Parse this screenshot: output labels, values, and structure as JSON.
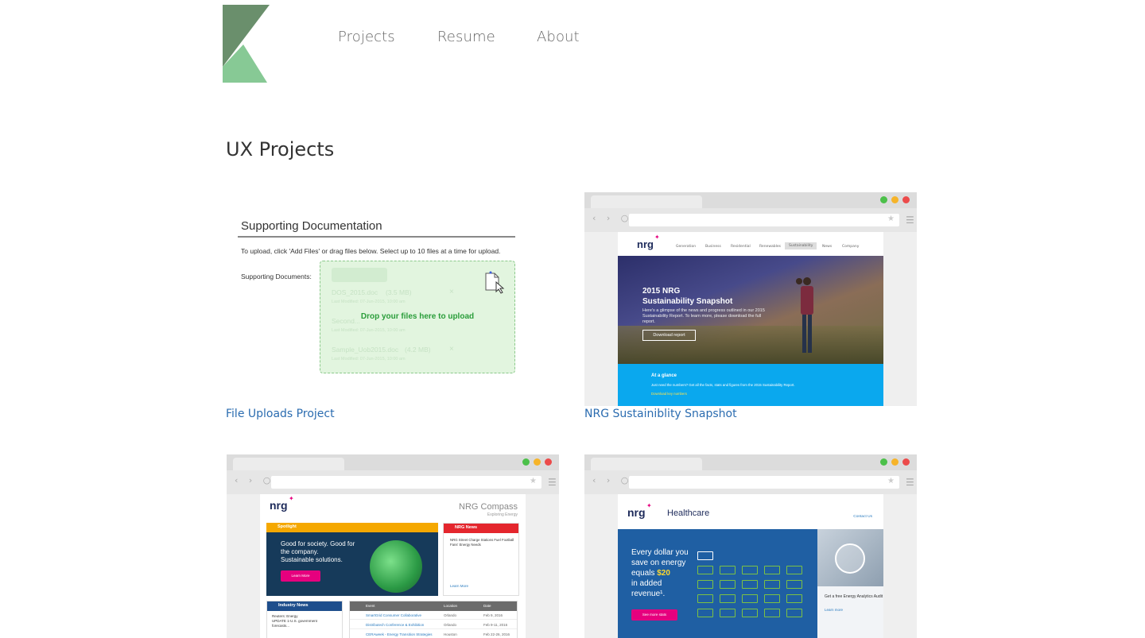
{
  "nav": {
    "projects": "Projects",
    "resume": "Resume",
    "about": "About"
  },
  "page": {
    "title": "UX Projects"
  },
  "colors": {
    "logo_dark": "#6a8f6c",
    "logo_light": "#87c995",
    "link": "#2b6cb0"
  },
  "cards": [
    {
      "link": "File Uploads Project",
      "thumb": {
        "title": "Supporting Documentation",
        "instructions": "To upload, click 'Add Files' or drag files below. Select up to 10 files at a time for upload.",
        "label": "Supporting Documents:",
        "drop_text": "Drop your files here to upload",
        "files": [
          {
            "name": "DOS_2015.doc",
            "size": "(3.5 MB)",
            "meta": "Last Modified: 07-Jun-2015, 10:00 am"
          },
          {
            "name": "Second...",
            "size": "",
            "meta": "Last Modified: 07-Jun-2015, 10:00 am"
          },
          {
            "name": "Sample_Uob2015.doc",
            "size": "(4.2 MB)",
            "meta": "Last Modified: 07-Jun-2015, 10:00 am"
          }
        ]
      }
    },
    {
      "link": "NRG Sustainiblity Snapshot",
      "thumb": {
        "brand": "nrg",
        "nav": [
          "Generation",
          "Business",
          "Residential",
          "Renewables",
          "Sustainability",
          "News",
          "Company"
        ],
        "hero_title_1": "2015 NRG",
        "hero_title_2": "Sustainability Snapshot",
        "hero_desc": "Here's a glimpse of the news and progress outlined in our 2015 Sustainability Report. To learn more, please download the full report.",
        "hero_button": "Download report",
        "glance_title": "At a glance",
        "glance_desc": "Just need the numbers? Get all the facts, stats and figures from the 2015 Sustainability Report.",
        "glance_link": "Download key numbers"
      }
    },
    {
      "link": "",
      "thumb": {
        "brand": "nrg",
        "title": "NRG Compass",
        "subtitle": "Exploring Energy",
        "spotlight": "Spotlight",
        "spotlight_text_1": "Good for society. Good for",
        "spotlight_text_2": "the company.",
        "spotlight_text_3": "Sustainable solutions.",
        "spotlight_button": "Learn More",
        "news_title": "NRG News",
        "news_text": "NRG Street Charge Stations Fuel Football Fans' Energy Needs",
        "news_learn": "Learn More",
        "industry_title": "Industry News",
        "industry_lines": [
          "Reuters: Energy",
          "UPDATE 1-U.S. government",
          "forecasts..."
        ],
        "events_headers": [
          "Event",
          "Location",
          "Date"
        ],
        "events": [
          {
            "event": "SmartGrid Consumer Collaborative",
            "location": "Orlando",
            "date": "Feb 9, 2016"
          },
          {
            "event": "Distributech Conference & Exhibition",
            "location": "Orlando",
            "date": "Feb 9-11, 2016"
          },
          {
            "event": "CERAweek - Energy Transition Strategies",
            "location": "Houston",
            "date": "Feb 22-26, 2016"
          }
        ]
      }
    },
    {
      "link": "",
      "thumb": {
        "brand": "nrg",
        "title": "Healthcare",
        "contact": "Contact Us",
        "hero_line_1": "Every dollar you",
        "hero_line_2": "save on energy",
        "hero_line_3_pre": "equals",
        "hero_line_3_amount": "$20",
        "hero_line_4": "in added",
        "hero_line_5": "revenue¹.",
        "hero_button": "See more stats",
        "side_text": "Get a free Energy Analytics Audit",
        "side_link": "Learn more"
      }
    }
  ]
}
